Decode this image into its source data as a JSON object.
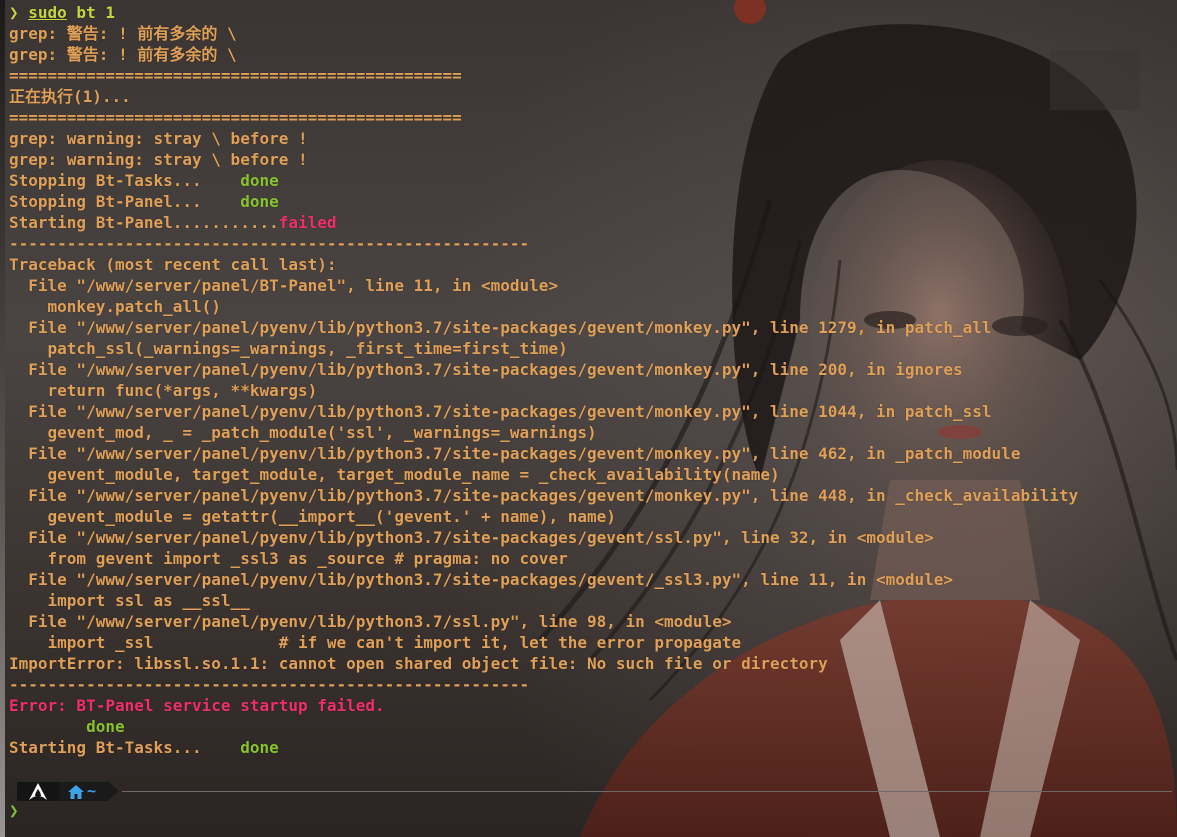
{
  "terminal": {
    "lines": [
      [
        {
          "t": "❯ ",
          "c": "prompt"
        },
        {
          "t": "sudo",
          "c": "prompt",
          "u": true
        },
        {
          "t": " bt 1",
          "c": "prompt"
        }
      ],
      [
        {
          "t": "grep: 警告: ! 前有多余的 \\",
          "c": "orange"
        }
      ],
      [
        {
          "t": "grep: 警告: ! 前有多余的 \\",
          "c": "orange"
        }
      ],
      [
        {
          "t": "===============================================",
          "c": "orange"
        }
      ],
      [
        {
          "t": "正在执行(1)...",
          "c": "orange"
        }
      ],
      [
        {
          "t": "===============================================",
          "c": "orange"
        }
      ],
      [
        {
          "t": "grep: warning: stray \\ before !",
          "c": "orange"
        }
      ],
      [
        {
          "t": "grep: warning: stray \\ before !",
          "c": "orange"
        }
      ],
      [
        {
          "t": "Stopping Bt-Tasks...    ",
          "c": "orange"
        },
        {
          "t": "done",
          "c": "green"
        }
      ],
      [
        {
          "t": "Stopping Bt-Panel...    ",
          "c": "orange"
        },
        {
          "t": "done",
          "c": "green"
        }
      ],
      [
        {
          "t": "Starting Bt-Panel...........",
          "c": "orange"
        },
        {
          "t": "failed",
          "c": "red"
        }
      ],
      [
        {
          "t": "------------------------------------------------------",
          "c": "orange"
        }
      ],
      [
        {
          "t": "Traceback (most recent call last):",
          "c": "orange"
        }
      ],
      [
        {
          "t": "  File \"/www/server/panel/BT-Panel\", line 11, in <module>",
          "c": "orange"
        }
      ],
      [
        {
          "t": "    monkey.patch_all()",
          "c": "orange"
        }
      ],
      [
        {
          "t": "  File \"/www/server/panel/pyenv/lib/python3.7/site-packages/gevent/monkey.py\", line 1279, in patch_all",
          "c": "orange"
        }
      ],
      [
        {
          "t": "    patch_ssl(_warnings=_warnings, _first_time=first_time)",
          "c": "orange"
        }
      ],
      [
        {
          "t": "  File \"/www/server/panel/pyenv/lib/python3.7/site-packages/gevent/monkey.py\", line 200, in ignores",
          "c": "orange"
        }
      ],
      [
        {
          "t": "    return func(*args, **kwargs)",
          "c": "orange"
        }
      ],
      [
        {
          "t": "  File \"/www/server/panel/pyenv/lib/python3.7/site-packages/gevent/monkey.py\", line 1044, in patch_ssl",
          "c": "orange"
        }
      ],
      [
        {
          "t": "    gevent_mod, _ = _patch_module('ssl', _warnings=_warnings)",
          "c": "orange"
        }
      ],
      [
        {
          "t": "  File \"/www/server/panel/pyenv/lib/python3.7/site-packages/gevent/monkey.py\", line 462, in _patch_module",
          "c": "orange"
        }
      ],
      [
        {
          "t": "    gevent_module, target_module, target_module_name = _check_availability(name)",
          "c": "orange"
        }
      ],
      [
        {
          "t": "  File \"/www/server/panel/pyenv/lib/python3.7/site-packages/gevent/monkey.py\", line 448, in _check_availability",
          "c": "orange"
        }
      ],
      [
        {
          "t": "    gevent_module = getattr(__import__('gevent.' + name), name)",
          "c": "orange"
        }
      ],
      [
        {
          "t": "  File \"/www/server/panel/pyenv/lib/python3.7/site-packages/gevent/ssl.py\", line 32, in <module>",
          "c": "orange"
        }
      ],
      [
        {
          "t": "    from gevent import _ssl3 as _source # pragma: no cover",
          "c": "orange"
        }
      ],
      [
        {
          "t": "  File \"/www/server/panel/pyenv/lib/python3.7/site-packages/gevent/_ssl3.py\", line 11, in <module>",
          "c": "orange"
        }
      ],
      [
        {
          "t": "    import ssl as __ssl__",
          "c": "orange"
        }
      ],
      [
        {
          "t": "  File \"/www/server/panel/pyenv/lib/python3.7/ssl.py\", line 98, in <module>",
          "c": "orange"
        }
      ],
      [
        {
          "t": "    import _ssl             # if we can't import it, let the error propagate",
          "c": "orange"
        }
      ],
      [
        {
          "t": "ImportError: libssl.so.1.1: cannot open shared object file: No such file or directory",
          "c": "orange"
        }
      ],
      [
        {
          "t": "------------------------------------------------------",
          "c": "orange"
        }
      ],
      [
        {
          "t": "Error: BT-Panel service startup failed.",
          "c": "red"
        }
      ],
      [
        {
          "t": "        done",
          "c": "green"
        }
      ],
      [
        {
          "t": "Starting Bt-Tasks...    ",
          "c": "orange"
        },
        {
          "t": "done",
          "c": "green"
        }
      ]
    ]
  },
  "prompt": {
    "os_icon": "arch-linux-icon",
    "dir_icon": "home-icon",
    "cwd": "~",
    "caret": "❯"
  },
  "colors": {
    "orange": "#e0a057",
    "green": "#88c22e",
    "red": "#ef2f6d",
    "prompt": "#c7d640",
    "dir": "#3fa3e8"
  }
}
